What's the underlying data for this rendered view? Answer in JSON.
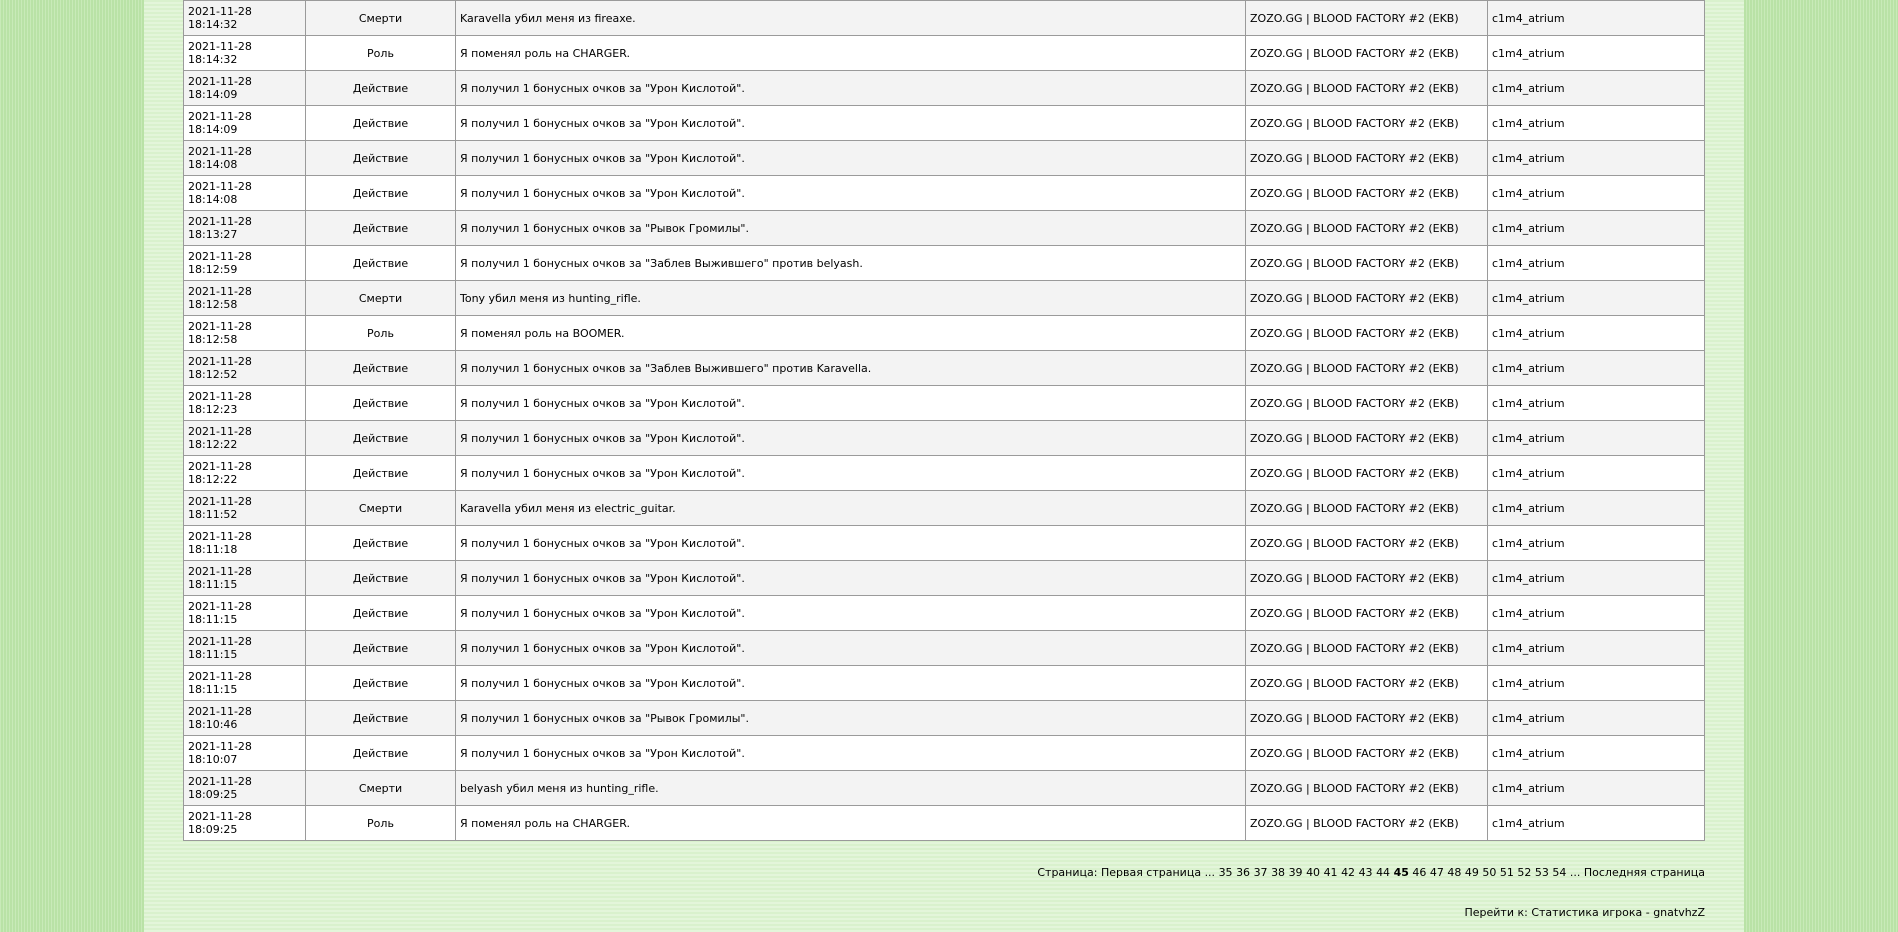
{
  "rows": [
    {
      "date": "2021-11-28",
      "time": "18:14:32",
      "type": "Смерти",
      "event": "Karavella убил меня из fireaxe.",
      "server": "ZOZO.GG | BLOOD FACTORY #2 (EKB)",
      "map": "c1m4_atrium"
    },
    {
      "date": "2021-11-28",
      "time": "18:14:32",
      "type": "Роль",
      "event": "Я поменял роль на CHARGER.",
      "server": "ZOZO.GG | BLOOD FACTORY #2 (EKB)",
      "map": "c1m4_atrium"
    },
    {
      "date": "2021-11-28",
      "time": "18:14:09",
      "type": "Действие",
      "event": "Я получил 1 бонусных очков за \"Урон Кислотой\".",
      "server": "ZOZO.GG | BLOOD FACTORY #2 (EKB)",
      "map": "c1m4_atrium"
    },
    {
      "date": "2021-11-28",
      "time": "18:14:09",
      "type": "Действие",
      "event": "Я получил 1 бонусных очков за \"Урон Кислотой\".",
      "server": "ZOZO.GG | BLOOD FACTORY #2 (EKB)",
      "map": "c1m4_atrium"
    },
    {
      "date": "2021-11-28",
      "time": "18:14:08",
      "type": "Действие",
      "event": "Я получил 1 бонусных очков за \"Урон Кислотой\".",
      "server": "ZOZO.GG | BLOOD FACTORY #2 (EKB)",
      "map": "c1m4_atrium"
    },
    {
      "date": "2021-11-28",
      "time": "18:14:08",
      "type": "Действие",
      "event": "Я получил 1 бонусных очков за \"Урон Кислотой\".",
      "server": "ZOZO.GG | BLOOD FACTORY #2 (EKB)",
      "map": "c1m4_atrium"
    },
    {
      "date": "2021-11-28",
      "time": "18:13:27",
      "type": "Действие",
      "event": "Я получил 1 бонусных очков за \"Рывок Громилы\".",
      "server": "ZOZO.GG | BLOOD FACTORY #2 (EKB)",
      "map": "c1m4_atrium"
    },
    {
      "date": "2021-11-28",
      "time": "18:12:59",
      "type": "Действие",
      "event": "Я получил 1 бонусных очков за \"Заблев Выжившего\" против belyash.",
      "server": "ZOZO.GG | BLOOD FACTORY #2 (EKB)",
      "map": "c1m4_atrium"
    },
    {
      "date": "2021-11-28",
      "time": "18:12:58",
      "type": "Смерти",
      "event": "Tony убил меня из hunting_rifle.",
      "server": "ZOZO.GG | BLOOD FACTORY #2 (EKB)",
      "map": "c1m4_atrium"
    },
    {
      "date": "2021-11-28",
      "time": "18:12:58",
      "type": "Роль",
      "event": "Я поменял роль на BOOMER.",
      "server": "ZOZO.GG | BLOOD FACTORY #2 (EKB)",
      "map": "c1m4_atrium"
    },
    {
      "date": "2021-11-28",
      "time": "18:12:52",
      "type": "Действие",
      "event": "Я получил 1 бонусных очков за \"Заблев Выжившего\" против Karavella.",
      "server": "ZOZO.GG | BLOOD FACTORY #2 (EKB)",
      "map": "c1m4_atrium"
    },
    {
      "date": "2021-11-28",
      "time": "18:12:23",
      "type": "Действие",
      "event": "Я получил 1 бонусных очков за \"Урон Кислотой\".",
      "server": "ZOZO.GG | BLOOD FACTORY #2 (EKB)",
      "map": "c1m4_atrium"
    },
    {
      "date": "2021-11-28",
      "time": "18:12:22",
      "type": "Действие",
      "event": "Я получил 1 бонусных очков за \"Урон Кислотой\".",
      "server": "ZOZO.GG | BLOOD FACTORY #2 (EKB)",
      "map": "c1m4_atrium"
    },
    {
      "date": "2021-11-28",
      "time": "18:12:22",
      "type": "Действие",
      "event": "Я получил 1 бонусных очков за \"Урон Кислотой\".",
      "server": "ZOZO.GG | BLOOD FACTORY #2 (EKB)",
      "map": "c1m4_atrium"
    },
    {
      "date": "2021-11-28",
      "time": "18:11:52",
      "type": "Смерти",
      "event": "Karavella убил меня из electric_guitar.",
      "server": "ZOZO.GG | BLOOD FACTORY #2 (EKB)",
      "map": "c1m4_atrium"
    },
    {
      "date": "2021-11-28",
      "time": "18:11:18",
      "type": "Действие",
      "event": "Я получил 1 бонусных очков за \"Урон Кислотой\".",
      "server": "ZOZO.GG | BLOOD FACTORY #2 (EKB)",
      "map": "c1m4_atrium"
    },
    {
      "date": "2021-11-28",
      "time": "18:11:15",
      "type": "Действие",
      "event": "Я получил 1 бонусных очков за \"Урон Кислотой\".",
      "server": "ZOZO.GG | BLOOD FACTORY #2 (EKB)",
      "map": "c1m4_atrium"
    },
    {
      "date": "2021-11-28",
      "time": "18:11:15",
      "type": "Действие",
      "event": "Я получил 1 бонусных очков за \"Урон Кислотой\".",
      "server": "ZOZO.GG | BLOOD FACTORY #2 (EKB)",
      "map": "c1m4_atrium"
    },
    {
      "date": "2021-11-28",
      "time": "18:11:15",
      "type": "Действие",
      "event": "Я получил 1 бонусных очков за \"Урон Кислотой\".",
      "server": "ZOZO.GG | BLOOD FACTORY #2 (EKB)",
      "map": "c1m4_atrium"
    },
    {
      "date": "2021-11-28",
      "time": "18:11:15",
      "type": "Действие",
      "event": "Я получил 1 бонусных очков за \"Урон Кислотой\".",
      "server": "ZOZO.GG | BLOOD FACTORY #2 (EKB)",
      "map": "c1m4_atrium"
    },
    {
      "date": "2021-11-28",
      "time": "18:10:46",
      "type": "Действие",
      "event": "Я получил 1 бонусных очков за \"Рывок Громилы\".",
      "server": "ZOZO.GG | BLOOD FACTORY #2 (EKB)",
      "map": "c1m4_atrium"
    },
    {
      "date": "2021-11-28",
      "time": "18:10:07",
      "type": "Действие",
      "event": "Я получил 1 бонусных очков за \"Урон Кислотой\".",
      "server": "ZOZO.GG | BLOOD FACTORY #2 (EKB)",
      "map": "c1m4_atrium"
    },
    {
      "date": "2021-11-28",
      "time": "18:09:25",
      "type": "Смерти",
      "event": "belyash убил меня из hunting_rifle.",
      "server": "ZOZO.GG | BLOOD FACTORY #2 (EKB)",
      "map": "c1m4_atrium"
    },
    {
      "date": "2021-11-28",
      "time": "18:09:25",
      "type": "Роль",
      "event": "Я поменял роль на CHARGER.",
      "server": "ZOZO.GG | BLOOD FACTORY #2 (EKB)",
      "map": "c1m4_atrium"
    }
  ],
  "pager": {
    "label": "Страница:",
    "first": "Первая страница",
    "ellipsis": "...",
    "pages_before": [
      "35",
      "36",
      "37",
      "38",
      "39",
      "40",
      "41",
      "42",
      "43",
      "44"
    ],
    "current": "45",
    "pages_after": [
      "46",
      "47",
      "48",
      "49",
      "50",
      "51",
      "52",
      "53",
      "54"
    ],
    "last": "Последняя страница"
  },
  "goto": {
    "label": "Перейти к:",
    "link": "Статистика игрока - gnatvhzZ"
  }
}
